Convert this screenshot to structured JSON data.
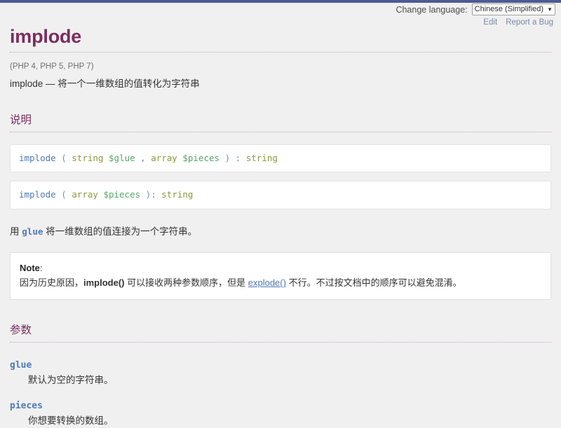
{
  "header": {
    "change_language_label": "Change language:",
    "language_value": "Chinese (Simplified)",
    "caret_glyph": "▼",
    "edit_link": "Edit",
    "report_bug_link": "Report a Bug"
  },
  "title": "implode",
  "version_info": "(PHP 4, PHP 5, PHP 7)",
  "refpurpose": "implode — 将一个一维数组的值转化为字符串",
  "sections": {
    "description_heading": "说明",
    "parameters_heading": "参数"
  },
  "synopsis": [
    {
      "name": "implode",
      "open": "(",
      "args": [
        {
          "type": "string",
          "param": "$glue"
        },
        {
          "type": "array",
          "param": "$pieces"
        }
      ],
      "separator": ",",
      "close": ")",
      "colon": ":",
      "return_type": "string"
    },
    {
      "name": "implode",
      "open": "(",
      "args": [
        {
          "type": "array",
          "param": "$pieces"
        }
      ],
      "separator": ",",
      "close": ")",
      "colon": ":",
      "return_type": "string"
    }
  ],
  "description": {
    "lead_in": "用 ",
    "code": "glue",
    "lead_out": " 将一维数组的值连接为一个字符串。"
  },
  "note": {
    "label": "Note",
    "label_colon": ":",
    "body_part1": "因为历史原因，",
    "body_bold": "implode()",
    "body_part2": " 可以接收两种参数顺序，但是 ",
    "body_link": "explode()",
    "body_part3": " 不行。不过按文档中的顺序可以避免混淆。"
  },
  "parameters": [
    {
      "name": "glue",
      "description": "默认为空的字符串。"
    },
    {
      "name": "pieces",
      "description": "你想要转换的数组。"
    }
  ],
  "colors": {
    "brand_bar": "#4f5b93",
    "title": "#7b2d5e",
    "code_function": "#4f7ab5",
    "code_type": "#8a9a39",
    "code_param": "#55a868",
    "link": "#4f7ab5",
    "page_background": "#f0f0f0"
  }
}
